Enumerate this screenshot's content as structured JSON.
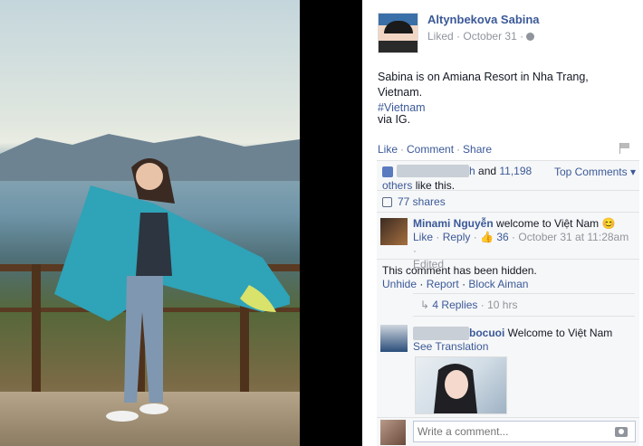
{
  "post": {
    "author": "Altynbekova Sabina",
    "liked_label": "Liked",
    "sep": "·",
    "date": "October 31",
    "text": "Sabina is on Amiana Resort in Nha Trang, Vietnam.",
    "hashtag": "#Vietnam",
    "via": "via IG."
  },
  "actions": {
    "like": "Like",
    "comment": "Comment",
    "share": "Share",
    "dot": "·"
  },
  "likes": {
    "blurred_names": "h",
    "and_text": " and ",
    "count": "11,198",
    "others": "others",
    "like_this": " like this.",
    "top_comments": "Top Comments ▾"
  },
  "shares": {
    "label": "77 shares"
  },
  "comment1": {
    "author": "Minami Nguyễn",
    "text": " welcome to Việt Nam 😊",
    "like": "Like",
    "reply": "Reply",
    "likes": "36",
    "time": "October 31 at 11:28am",
    "edited": "Edited"
  },
  "hidden": {
    "text": "This comment has been hidden.",
    "unhide": "Unhide",
    "report": "Report",
    "block": "Block Aiman"
  },
  "replies": {
    "label": "4 Replies",
    "time": "10 hrs"
  },
  "comment2": {
    "author": "bocuoi",
    "text": " Welcome to Việt Nam",
    "see_translation": "See Translation"
  },
  "composer": {
    "placeholder": "Write a comment..."
  },
  "icons": {
    "avatar": "profile-avatar",
    "camera": "camera-icon",
    "thumb": "thumbs-up-icon",
    "share": "share-icon",
    "flag": "flag-icon",
    "globe": "globe-icon"
  },
  "colors": {
    "link": "#3b5998",
    "muted": "#90949c",
    "panel": "#f6f7f8"
  }
}
